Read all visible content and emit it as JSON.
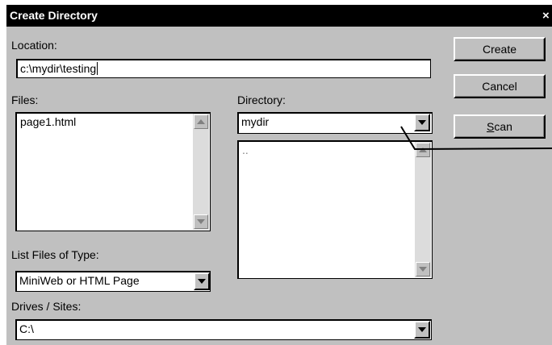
{
  "window": {
    "title": "Create Directory",
    "close_glyph": "×"
  },
  "location": {
    "label": "Location:",
    "value": "c:\\mydir\\testing"
  },
  "files": {
    "label": "Files:",
    "items": [
      "page1.html"
    ]
  },
  "directory": {
    "label": "Directory:",
    "selected": "mydir",
    "items": [
      ".."
    ]
  },
  "file_type": {
    "label": "List Files of Type:",
    "selected": "MiniWeb or HTML Page"
  },
  "drives": {
    "label": "Drives / Sites:",
    "selected": "C:\\"
  },
  "buttons": {
    "create": "Create",
    "cancel": "Cancel",
    "scan_mnemonic": "S",
    "scan_rest": "can"
  }
}
